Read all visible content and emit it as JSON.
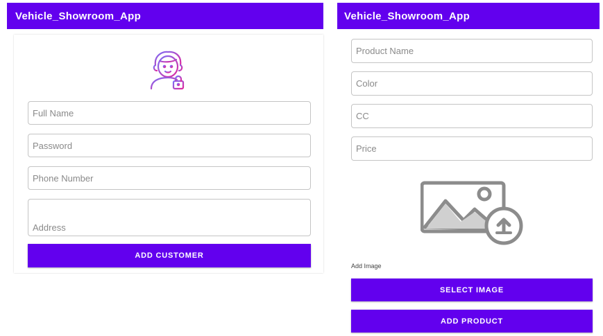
{
  "left_screen": {
    "app_title": "Vehicle_Showroom_App",
    "avatar_icon": "user-lock-icon",
    "fields": {
      "full_name": "Full Name",
      "password": "Password",
      "phone_number": "Phone Number",
      "address": "Address"
    },
    "add_customer_label": "ADD CUSTOMER"
  },
  "right_screen": {
    "app_title": "Vehicle_Showroom_App",
    "fields": {
      "product_name": "Product Name",
      "color": "Color",
      "cc": "CC",
      "price": "Price"
    },
    "image_icon": "image-upload-icon",
    "add_image_label": "Add Image",
    "select_image_label": "SELECT IMAGE",
    "add_product_label": "ADD PRODUCT"
  },
  "colors": {
    "primary": "#6200ee",
    "field_border": "#c4c4c4",
    "placeholder_text": "#8a8a8a",
    "avatar_gradient_start": "#7b2ff7",
    "avatar_gradient_end": "#f107a3"
  }
}
